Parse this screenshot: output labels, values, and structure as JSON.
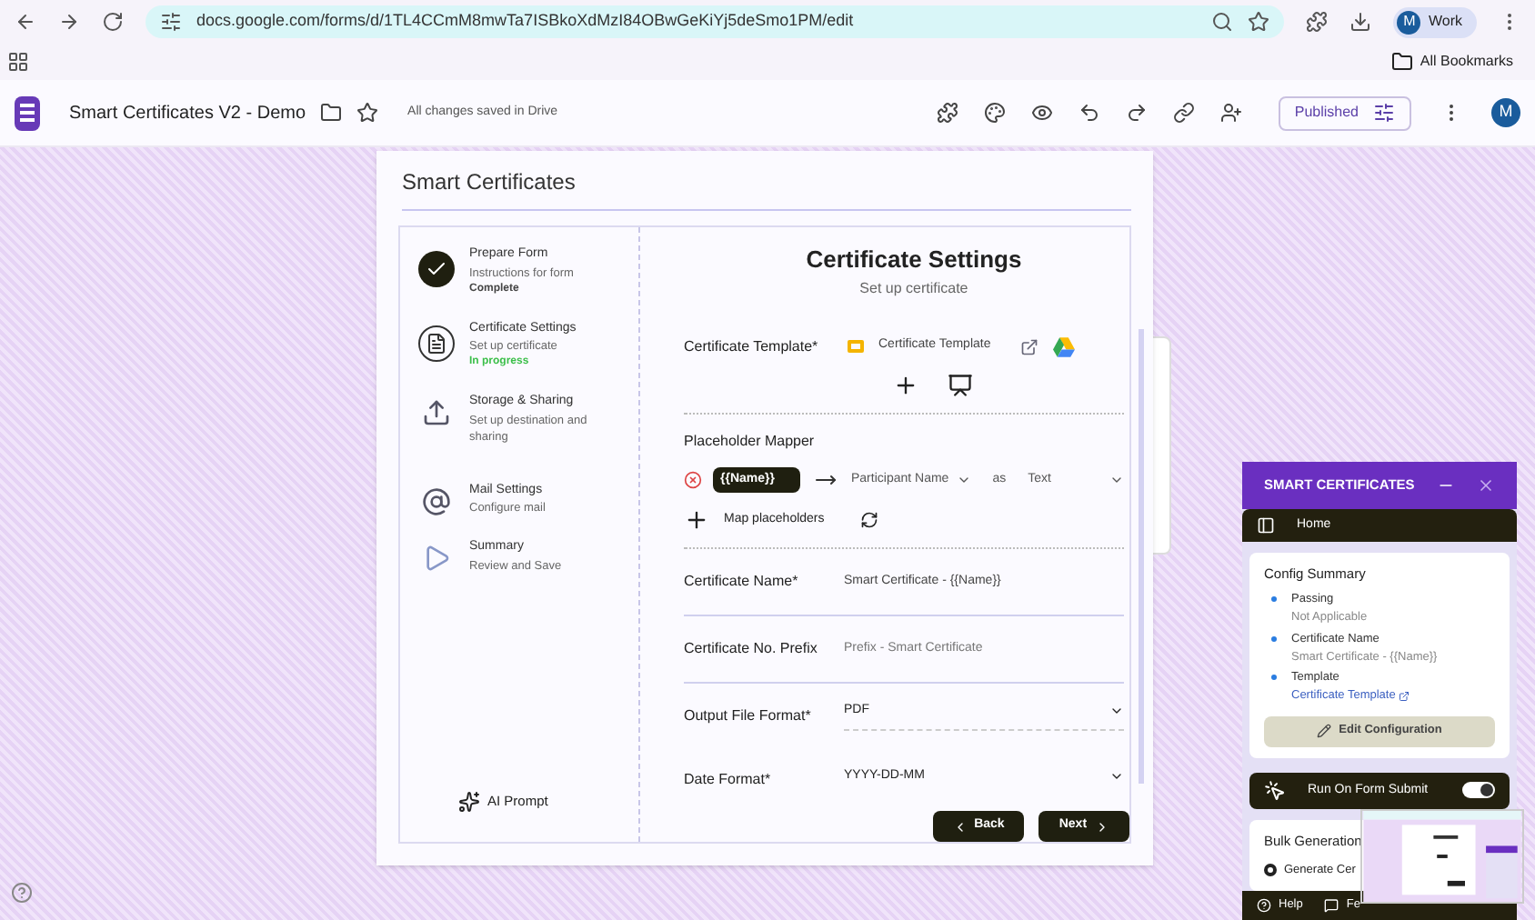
{
  "browser": {
    "url": "docs.google.com/forms/d/1TL4CCmM8mwTa7ISBkoXdMzI84OBwGeKiYj5deSmo1PM/edit",
    "profile_initial": "M",
    "profile_label": "Work",
    "bookmarks_label": "All Bookmarks"
  },
  "doc_header": {
    "title": "Smart Certificates V2 - Demo",
    "save_status": "All changes saved in Drive",
    "publish_button": "Published",
    "avatar_initial": "M"
  },
  "dialog": {
    "title": "Smart Certificates",
    "steps": [
      {
        "title": "Prepare Form",
        "subtitle": "Instructions for form",
        "status": "Complete",
        "kind": "done"
      },
      {
        "title": "Certificate Settings",
        "subtitle": "Set up certificate",
        "status": "In progress",
        "kind": "current"
      },
      {
        "title": "Storage & Sharing",
        "subtitle": "Set up destination and sharing",
        "kind": "upload"
      },
      {
        "title": "Mail Settings",
        "subtitle": "Configure mail",
        "kind": "mail"
      },
      {
        "title": "Summary",
        "subtitle": "Review and Save",
        "kind": "play"
      }
    ],
    "ai_prompt": "AI Prompt",
    "heading": "Certificate Settings",
    "subheading": "Set up certificate",
    "template": {
      "label": "Certificate Template*",
      "file": "Certificate Template"
    },
    "mapper": {
      "label": "Placeholder Mapper",
      "placeholder": "{{Name}}",
      "field": "Participant Name",
      "as_label": "as",
      "type": "Text",
      "map_button": "Map placeholders"
    },
    "fields": [
      {
        "label": "Certificate Name*",
        "value": "Smart Certificate - {{Name}}",
        "kind": "text"
      },
      {
        "label": "Certificate No. Prefix",
        "placeholder": "Prefix - Smart Certificate",
        "kind": "text"
      },
      {
        "label": "Output File Format*",
        "value": "PDF",
        "kind": "select"
      },
      {
        "label": "Date Format*",
        "value": "YYYY-DD-MM",
        "kind": "select"
      }
    ],
    "back_button": "Back",
    "next_button": "Next"
  },
  "side_panel": {
    "title": "SMART CERTIFICATES",
    "home": "Home",
    "summary_title": "Config Summary",
    "summary_items": [
      {
        "label": "Passing",
        "value": "Not Applicable",
        "kind": "text"
      },
      {
        "label": "Certificate Name",
        "value": "Smart Certificate - {{Name}}",
        "kind": "text"
      },
      {
        "label": "Template",
        "value": "Certificate Template",
        "kind": "link"
      }
    ],
    "edit_button": "Edit Configuration",
    "run_on_submit": {
      "label": "Run On Form Submit",
      "on": true
    },
    "bulk_title": "Bulk Generation",
    "bulk_option": "Generate Cer",
    "help": "Help",
    "feedback": "Fe"
  }
}
